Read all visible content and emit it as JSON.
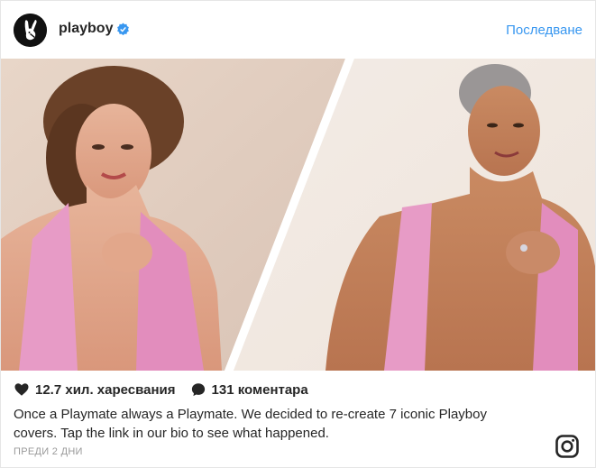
{
  "header": {
    "username": "playboy",
    "follow_label": "Последване"
  },
  "post": {
    "likes_label": "12.7 хил. харесвания",
    "comments_label": "131 коментара",
    "caption_line1": "Once a Playmate always a Playmate. We decided to re-create 7 iconic Playboy",
    "caption_line2": "covers. Tap the link in our bio to see what happened.",
    "timestamp": "ПРЕДИ 2 ДНИ"
  },
  "colors": {
    "accent": "#3897f0",
    "pink_top": "#e79bc6",
    "background": "#f0ece8"
  },
  "icons": {
    "avatar": "playboy-bunny-logo",
    "verified": "verified-badge-icon",
    "like": "heart-icon",
    "comment": "comment-bubble-icon",
    "brand": "instagram-icon"
  }
}
